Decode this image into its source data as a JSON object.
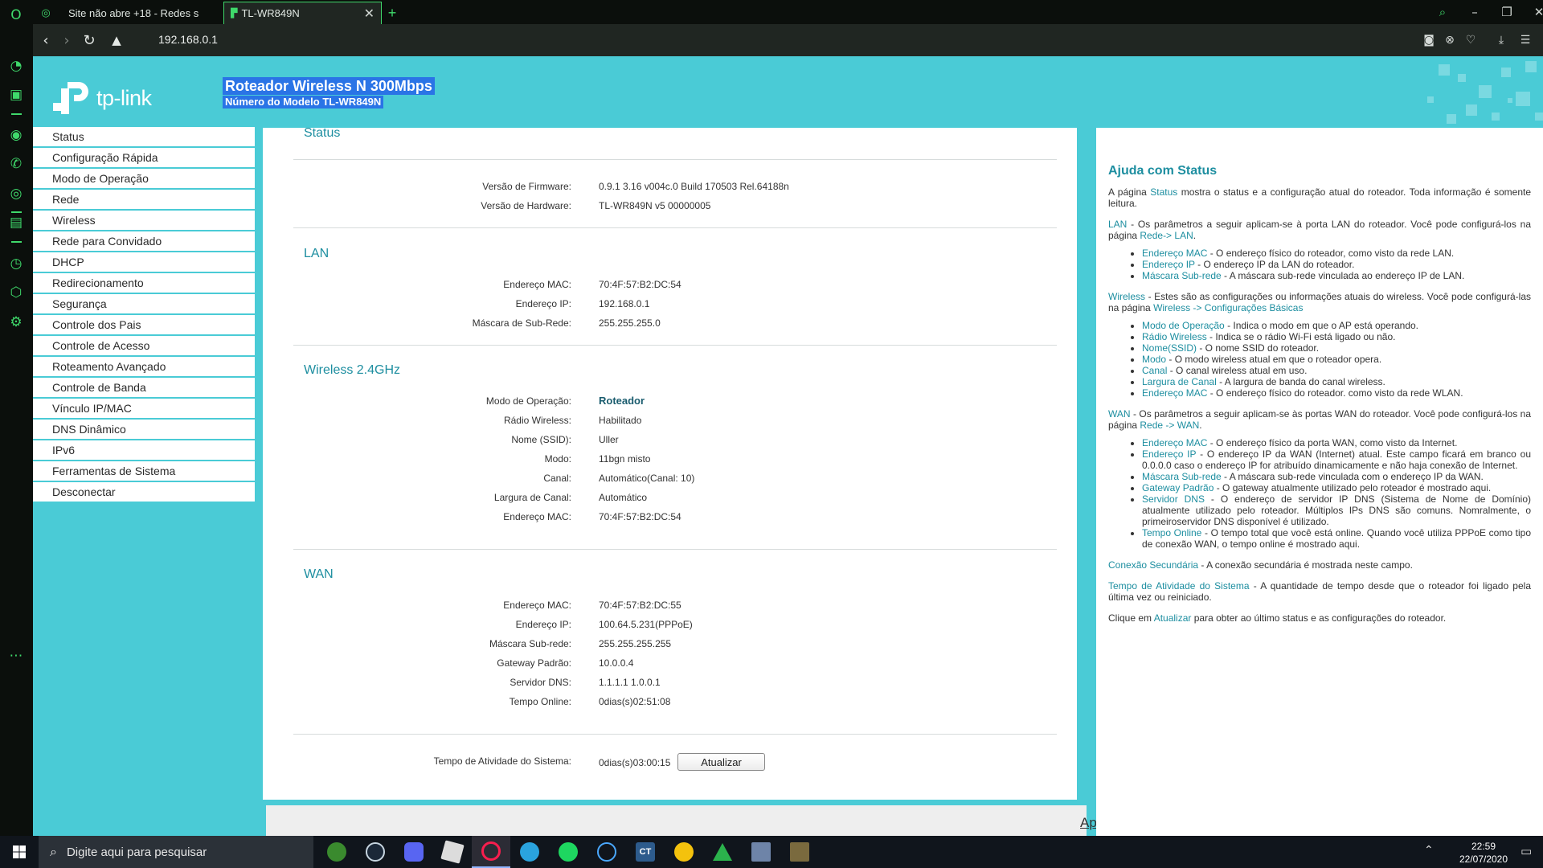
{
  "browser": {
    "tabs": [
      {
        "label": "Site não abre +18 - Redes s"
      },
      {
        "label": "TL-WR849N"
      }
    ],
    "new_tab": "+",
    "url": "192.168.0.1"
  },
  "header": {
    "logo_text": "tp-link",
    "title": "Roteador Wireless N 300Mbps",
    "model": "Número do Modelo TL-WR849N"
  },
  "sidebar": {
    "items": [
      "Status",
      "Configuração Rápida",
      "Modo de Operação",
      "Rede",
      "Wireless",
      "Rede para Convidado",
      "DHCP",
      "Redirecionamento",
      "Segurança",
      "Controle dos Pais",
      "Controle de Acesso",
      "Roteamento Avançado",
      "Controle de Banda",
      "Vínculo IP/MAC",
      "DNS Dinâmico",
      "IPv6",
      "Ferramentas de Sistema",
      "Desconectar"
    ]
  },
  "status": {
    "title": "Status",
    "firmware_label": "Versão de Firmware:",
    "firmware_value": "0.9.1 3.16 v004c.0 Build 170503 Rel.64188n",
    "hardware_label": "Versão de Hardware:",
    "hardware_value": "TL-WR849N v5 00000005",
    "lan": {
      "title": "LAN",
      "mac_label": "Endereço MAC:",
      "mac": "70:4F:57:B2:DC:54",
      "ip_label": "Endereço IP:",
      "ip": "192.168.0.1",
      "mask_label": "Máscara de Sub-Rede:",
      "mask": "255.255.255.0"
    },
    "wireless": {
      "title": "Wireless 2.4GHz",
      "mode_label": "Modo de Operação:",
      "mode": "Roteador",
      "radio_label": "Rádio Wireless:",
      "radio": "Habilitado",
      "ssid_label": "Nome (SSID):",
      "ssid": "Uller",
      "modo_label": "Modo:",
      "modo": "11bgn misto",
      "channel_label": "Canal:",
      "channel": "Automático(Canal: 10)",
      "width_label": "Largura de Canal:",
      "width": "Automático",
      "mac_label": "Endereço MAC:",
      "mac": "70:4F:57:B2:DC:54"
    },
    "wan": {
      "title": "WAN",
      "mac_label": "Endereço MAC:",
      "mac": "70:4F:57:B2:DC:55",
      "ip_label": "Endereço IP:",
      "ip": "100.64.5.231(PPPoE)",
      "mask_label": "Máscara Sub-rede:",
      "mask": "255.255.255.255",
      "gw_label": "Gateway Padrão:",
      "gw": "10.0.0.4",
      "dns_label": "Servidor DNS:",
      "dns": "1.1.1.1 1.0.0.1",
      "online_label": "Tempo Online:",
      "online": "0dias(s)02:51:08"
    },
    "uptime_label": "Tempo de Atividade do Sistema:",
    "uptime": "0dias(s)03:00:15",
    "refresh_button": "Atualizar"
  },
  "app_link": "App",
  "help": {
    "title": "Ajuda com Status",
    "intro_pre": "A página ",
    "intro_hl": "Status",
    "intro_post": " mostra o status e a configuração atual do roteador. Toda informação é somente leitura.",
    "lan_hl": "LAN",
    "lan_text": " - Os parâmetros a seguir aplicam-se à porta LAN do roteador. Você pode configurá-los na página ",
    "lan_link": "Rede-> LAN",
    "lan_items": [
      {
        "k": "Endereço MAC",
        "v": " - O endereço físico do roteador, como visto da rede LAN."
      },
      {
        "k": "Endereço IP",
        "v": " - O endereço IP da LAN do roteador."
      },
      {
        "k": "Máscara Sub-rede",
        "v": " - A máscara sub-rede vinculada ao endereço IP de LAN."
      }
    ],
    "wl_hl": "Wireless",
    "wl_text": " - Estes são as configurações ou informações atuais do wireless. Você pode configurá-las na página ",
    "wl_link": "Wireless -> Configurações Básicas",
    "wl_items": [
      {
        "k": "Modo de Operação",
        "v": " - Indica o modo em que o AP está operando."
      },
      {
        "k": "Rádio Wireless",
        "v": " - Indica se o rádio Wi-Fi está ligado ou não."
      },
      {
        "k": "Nome(SSID)",
        "v": " - O nome SSID do roteador."
      },
      {
        "k": "Modo",
        "v": " - O modo wireless atual em que o roteador opera."
      },
      {
        "k": "Canal",
        "v": " - O canal wireless atual em uso."
      },
      {
        "k": "Largura de Canal",
        "v": " - A largura de banda do canal wireless."
      },
      {
        "k": "Endereço MAC",
        "v": " - O endereço físico do roteador. como visto da rede WLAN."
      }
    ],
    "wan_hl": "WAN",
    "wan_text": " - Os parâmetros a seguir aplicam-se às portas WAN do roteador. Você pode configurá-los na página ",
    "wan_link": "Rede -> WAN",
    "wan_items": [
      {
        "k": "Endereço MAC",
        "v": " - O endereço físico da porta WAN, como visto da Internet."
      },
      {
        "k": "Endereço IP",
        "v": " - O endereço IP da WAN (Internet) atual. Este campo ficará em branco ou 0.0.0.0 caso o endereço IP for atribuído dinamicamente e não haja conexão de Internet."
      },
      {
        "k": "Máscara Sub-rede",
        "v": " - A máscara sub-rede vinculada com o endereço IP da WAN."
      },
      {
        "k": "Gateway Padrão",
        "v": " - O gateway atualmente utilizado pelo roteador é mostrado aqui."
      },
      {
        "k": "Servidor DNS",
        "v": " - O endereço de servidor IP DNS (Sistema de Nome de Domínio) atualmente utilizado pelo roteador. Múltiplos IPs DNS são comuns. Nomralmente, o primeiroservidor DNS disponível é utilizado."
      },
      {
        "k": "Tempo Online",
        "v": " - O tempo total que você está online. Quando você utiliza PPPoE como tipo de conexão WAN, o tempo online é mostrado aqui."
      }
    ],
    "sec_hl": "Conexão Secundária",
    "sec_text": " - A conexão secundária é mostrada neste campo.",
    "up_hl": "Tempo de Atividade do Sistema",
    "up_text": " - A quantidade de tempo desde que o roteador foi ligado pela última vez ou reiniciado.",
    "click_pre": "Clique em ",
    "click_hl": "Atualizar",
    "click_post": " para obter ao último status e as configurações do roteador."
  },
  "taskbar": {
    "search_placeholder": "Digite aqui para pesquisar",
    "ct_label": "CT",
    "time": "22:59",
    "date": "22/07/2020"
  },
  "colors": {
    "opera_green": "#3fd96b",
    "tplink_teal": "#4acbd6",
    "heading_teal": "#1d8ea0",
    "highlight_blue": "#2a74e6"
  }
}
